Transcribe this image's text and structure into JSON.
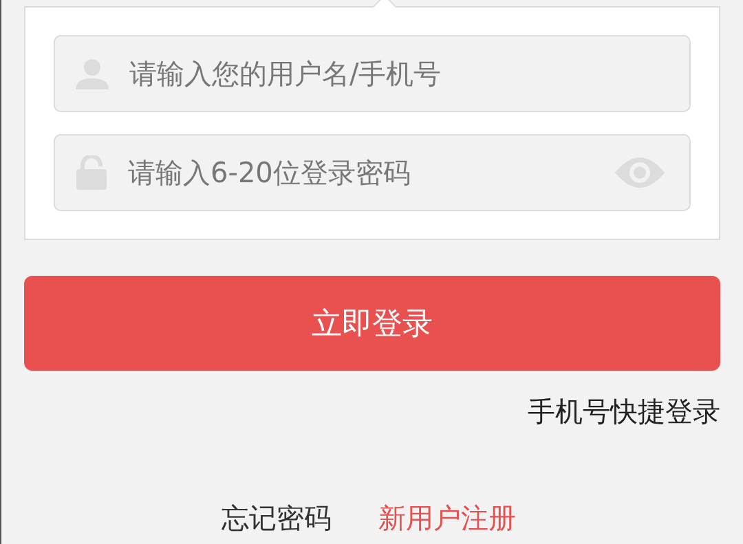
{
  "fields": [
    {
      "kind": "username",
      "placeholder": "请输入您的用户名/手机号"
    },
    {
      "kind": "password",
      "placeholder": "请输入6-20位登录密码"
    }
  ],
  "login_button": "立即登录",
  "quick_login_link": "手机号快捷登录",
  "bottom_links": [
    {
      "kind": "plain",
      "label": "忘记密码"
    },
    {
      "kind": "accent",
      "label": "新用户注册"
    }
  ]
}
